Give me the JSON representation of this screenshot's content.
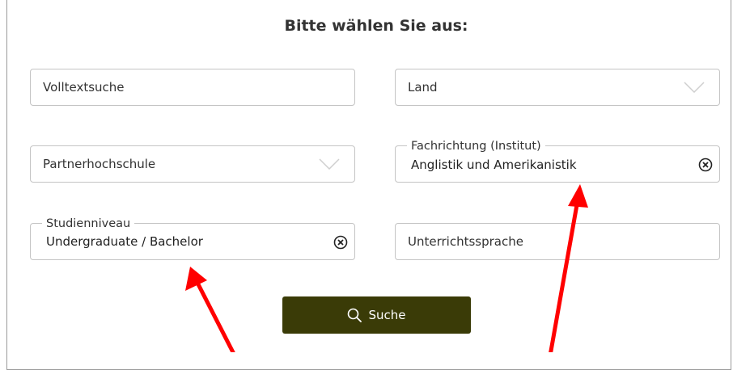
{
  "form": {
    "heading": "Bitte wählen Sie aus:",
    "fulltext_placeholder": "Volltextsuche",
    "country_placeholder": "Land",
    "partner_placeholder": "Partnerhochschule",
    "department_label": "Fachrichtung (Institut)",
    "department_value": "Anglistik und Amerikanistik",
    "level_label": "Studienniveau",
    "level_value": "Undergraduate / Bachelor",
    "language_placeholder": "Unterrichtssprache",
    "search_label": "Suche"
  },
  "icons": {
    "dropdown": "chevron-down-icon",
    "clear": "clear-circle-x-icon",
    "search": "magnifier-icon"
  },
  "colors": {
    "button_bg": "#3a3b07",
    "border": "#c4c4c4",
    "annotation_arrow": "#ff0000"
  }
}
